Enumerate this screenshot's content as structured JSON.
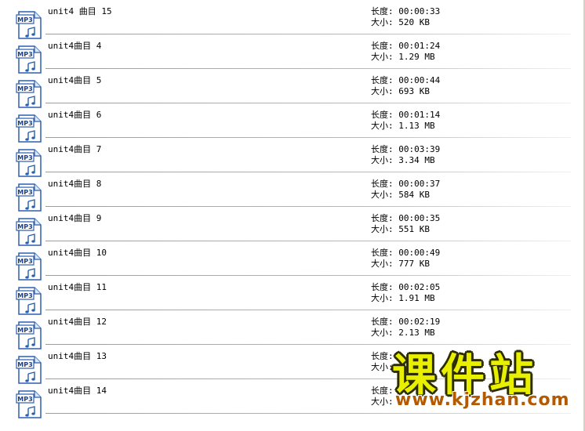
{
  "file_list": {
    "items": [
      {
        "name": "unit4 曲目 15",
        "icon": "mp3-file-icon",
        "icon_label": "MP3",
        "duration": "长度: 00:00:33",
        "size": "大小: 520 KB"
      },
      {
        "name": "unit4曲目 4",
        "icon": "mp3-file-icon",
        "icon_label": "MP3",
        "duration": "长度: 00:01:24",
        "size": "大小: 1.29 MB"
      },
      {
        "name": "unit4曲目 5",
        "icon": "mp3-file-icon",
        "icon_label": "MP3",
        "duration": "长度: 00:00:44",
        "size": "大小: 693 KB"
      },
      {
        "name": "unit4曲目 6",
        "icon": "mp3-file-icon",
        "icon_label": "MP3",
        "duration": "长度: 00:01:14",
        "size": "大小: 1.13 MB"
      },
      {
        "name": "unit4曲目 7",
        "icon": "mp3-file-icon",
        "icon_label": "MP3",
        "duration": "长度: 00:03:39",
        "size": "大小: 3.34 MB"
      },
      {
        "name": "unit4曲目 8",
        "icon": "mp3-file-icon",
        "icon_label": "MP3",
        "duration": "长度: 00:00:37",
        "size": "大小: 584 KB"
      },
      {
        "name": "unit4曲目 9",
        "icon": "mp3-file-icon",
        "icon_label": "MP3",
        "duration": "长度: 00:00:35",
        "size": "大小: 551 KB"
      },
      {
        "name": "unit4曲目 10",
        "icon": "mp3-file-icon",
        "icon_label": "MP3",
        "duration": "长度: 00:00:49",
        "size": "大小: 777 KB"
      },
      {
        "name": "unit4曲目 11",
        "icon": "mp3-file-icon",
        "icon_label": "MP3",
        "duration": "长度: 00:02:05",
        "size": "大小: 1.91 MB"
      },
      {
        "name": "unit4曲目 12",
        "icon": "mp3-file-icon",
        "icon_label": "MP3",
        "duration": "长度: 00:02:19",
        "size": "大小: 2.13 MB"
      },
      {
        "name": "unit4曲目 13",
        "icon": "mp3-file-icon",
        "icon_label": "MP3",
        "duration": "长度:",
        "size": "大小:"
      },
      {
        "name": "unit4曲目 14",
        "icon": "mp3-file-icon",
        "icon_label": "MP3",
        "duration": "长度:",
        "size": "大小:"
      }
    ]
  },
  "watermark": {
    "title": "课件站",
    "url": "www.kjzhan.com"
  },
  "colors": {
    "icon_blue": "#2b5fb0",
    "watermark_yellow": "#e8f000",
    "watermark_url": "#b35a00"
  }
}
